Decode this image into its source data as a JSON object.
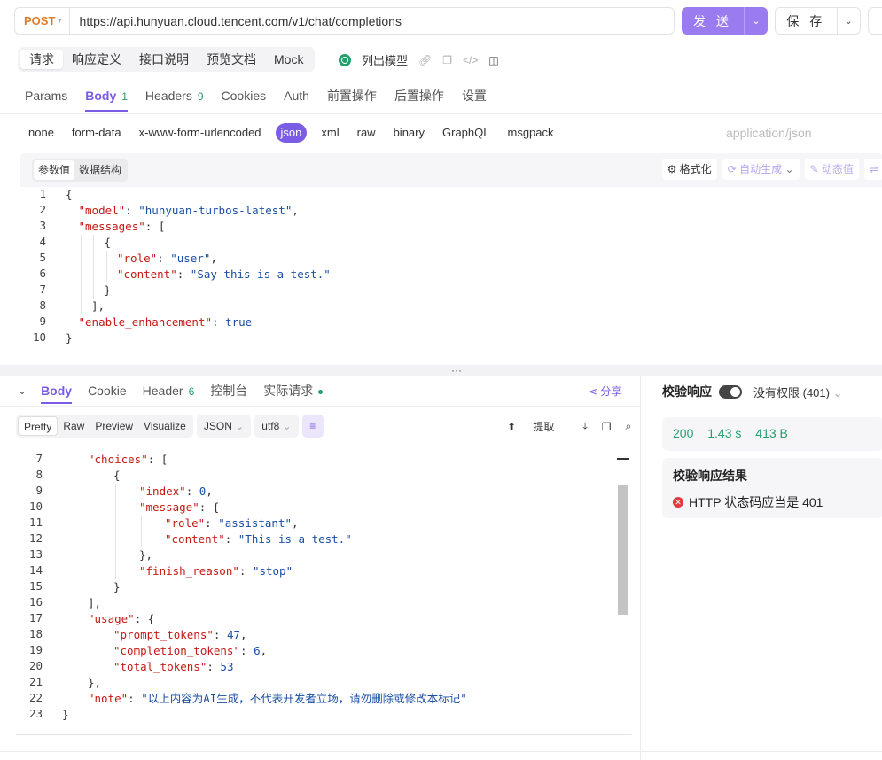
{
  "request": {
    "method": "POST",
    "url": "https://api.hunyuan.cloud.tencent.com/v1/chat/completions",
    "send_label": "发 送",
    "save_label": "保 存"
  },
  "top_tabs": [
    "请求",
    "响应定义",
    "接口说明",
    "预览文档",
    "Mock"
  ],
  "list_models_label": "列出模型",
  "sub_tabs": [
    {
      "label": "Params",
      "badge": ""
    },
    {
      "label": "Body",
      "badge": "1"
    },
    {
      "label": "Headers",
      "badge": "9"
    },
    {
      "label": "Cookies",
      "badge": ""
    },
    {
      "label": "Auth",
      "badge": ""
    },
    {
      "label": "前置操作",
      "badge": ""
    },
    {
      "label": "后置操作",
      "badge": ""
    },
    {
      "label": "设置",
      "badge": ""
    }
  ],
  "body_types": [
    "none",
    "form-data",
    "x-www-form-urlencoded",
    "json",
    "xml",
    "raw",
    "binary",
    "GraphQL",
    "msgpack"
  ],
  "content_type": "application/json",
  "editor": {
    "seg_values": "参数值",
    "seg_schema": "数据结构",
    "format_label": "格式化",
    "auto_gen_label": "自动生成",
    "dynamic_label": "动态值"
  },
  "request_body_lines": [
    {
      "n": "1",
      "indent": 0,
      "parts": [
        [
          "p",
          "{"
        ]
      ]
    },
    {
      "n": "2",
      "indent": 1,
      "parts": [
        [
          "k",
          "\"model\""
        ],
        [
          "p",
          ": "
        ],
        [
          "s",
          "\"hunyuan-turbos-latest\""
        ],
        [
          "p",
          ","
        ]
      ]
    },
    {
      "n": "3",
      "indent": 1,
      "parts": [
        [
          "k",
          "\"messages\""
        ],
        [
          "p",
          ": ["
        ]
      ]
    },
    {
      "n": "4",
      "indent": 3,
      "parts": [
        [
          "p",
          "{"
        ]
      ]
    },
    {
      "n": "5",
      "indent": 4,
      "parts": [
        [
          "k",
          "\"role\""
        ],
        [
          "p",
          ": "
        ],
        [
          "s",
          "\"user\""
        ],
        [
          "p",
          ","
        ]
      ]
    },
    {
      "n": "6",
      "indent": 4,
      "parts": [
        [
          "k",
          "\"content\""
        ],
        [
          "p",
          ": "
        ],
        [
          "s",
          "\"Say this is a test.\""
        ]
      ]
    },
    {
      "n": "7",
      "indent": 3,
      "parts": [
        [
          "p",
          "}"
        ]
      ]
    },
    {
      "n": "8",
      "indent": 2,
      "parts": [
        [
          "p",
          "],"
        ]
      ]
    },
    {
      "n": "9",
      "indent": 1,
      "parts": [
        [
          "k",
          "\"enable_enhancement\""
        ],
        [
          "p",
          ": "
        ],
        [
          "b",
          "true"
        ]
      ]
    },
    {
      "n": "10",
      "indent": 0,
      "parts": [
        [
          "p",
          "}"
        ]
      ]
    }
  ],
  "response_tabs": [
    {
      "label": "Body",
      "badge": ""
    },
    {
      "label": "Cookie",
      "badge": ""
    },
    {
      "label": "Header",
      "badge": "6"
    },
    {
      "label": "控制台",
      "badge": ""
    },
    {
      "label": "实际请求",
      "badge": ""
    }
  ],
  "share_label": "分享",
  "resp_views": [
    "Pretty",
    "Raw",
    "Preview",
    "Visualize"
  ],
  "resp_format": "JSON",
  "resp_encoding": "utf8",
  "extract_label": "提取",
  "response_lines": [
    {
      "n": "7",
      "indent": 1,
      "parts": [
        [
          "k",
          "\"choices\""
        ],
        [
          "p",
          ": ["
        ]
      ]
    },
    {
      "n": "8",
      "indent": 2,
      "parts": [
        [
          "p",
          "{"
        ]
      ]
    },
    {
      "n": "9",
      "indent": 3,
      "parts": [
        [
          "k",
          "\"index\""
        ],
        [
          "p",
          ": "
        ],
        [
          "n",
          "0"
        ],
        [
          "p",
          ","
        ]
      ]
    },
    {
      "n": "10",
      "indent": 3,
      "parts": [
        [
          "k",
          "\"message\""
        ],
        [
          "p",
          ": {"
        ]
      ]
    },
    {
      "n": "11",
      "indent": 4,
      "parts": [
        [
          "k",
          "\"role\""
        ],
        [
          "p",
          ": "
        ],
        [
          "s",
          "\"assistant\""
        ],
        [
          "p",
          ","
        ]
      ]
    },
    {
      "n": "12",
      "indent": 4,
      "parts": [
        [
          "k",
          "\"content\""
        ],
        [
          "p",
          ": "
        ],
        [
          "s",
          "\"This is a test.\""
        ]
      ]
    },
    {
      "n": "13",
      "indent": 3,
      "parts": [
        [
          "p",
          "},"
        ]
      ]
    },
    {
      "n": "14",
      "indent": 3,
      "parts": [
        [
          "k",
          "\"finish_reason\""
        ],
        [
          "p",
          ": "
        ],
        [
          "s",
          "\"stop\""
        ]
      ]
    },
    {
      "n": "15",
      "indent": 2,
      "parts": [
        [
          "p",
          "}"
        ]
      ]
    },
    {
      "n": "16",
      "indent": 1,
      "parts": [
        [
          "p",
          "],"
        ]
      ]
    },
    {
      "n": "17",
      "indent": 1,
      "parts": [
        [
          "k",
          "\"usage\""
        ],
        [
          "p",
          ": {"
        ]
      ]
    },
    {
      "n": "18",
      "indent": 2,
      "parts": [
        [
          "k",
          "\"prompt_tokens\""
        ],
        [
          "p",
          ": "
        ],
        [
          "n",
          "47"
        ],
        [
          "p",
          ","
        ]
      ]
    },
    {
      "n": "19",
      "indent": 2,
      "parts": [
        [
          "k",
          "\"completion_tokens\""
        ],
        [
          "p",
          ": "
        ],
        [
          "n",
          "6"
        ],
        [
          "p",
          ","
        ]
      ]
    },
    {
      "n": "20",
      "indent": 2,
      "parts": [
        [
          "k",
          "\"total_tokens\""
        ],
        [
          "p",
          ": "
        ],
        [
          "n",
          "53"
        ]
      ]
    },
    {
      "n": "21",
      "indent": 1,
      "parts": [
        [
          "p",
          "},"
        ]
      ]
    },
    {
      "n": "22",
      "indent": 1,
      "parts": [
        [
          "k",
          "\"note\""
        ],
        [
          "p",
          ": "
        ],
        [
          "s",
          "\"以上内容为AI生成，不代表开发者立场，请勿删除或修改本标记\""
        ]
      ]
    },
    {
      "n": "23",
      "indent": 0,
      "parts": [
        [
          "p",
          "}"
        ]
      ]
    }
  ],
  "validate": {
    "title": "校验响应",
    "permission": "没有权限 (401)",
    "status_code": "200",
    "time": "1.43 s",
    "size": "413 B",
    "result_title": "校验响应结果",
    "result_message": "HTTP 状态码应当是 401"
  },
  "colors": {
    "accent": "#7b5ce5",
    "success": "#22a06b",
    "error": "#e0393e",
    "method": "#e07b2a"
  }
}
